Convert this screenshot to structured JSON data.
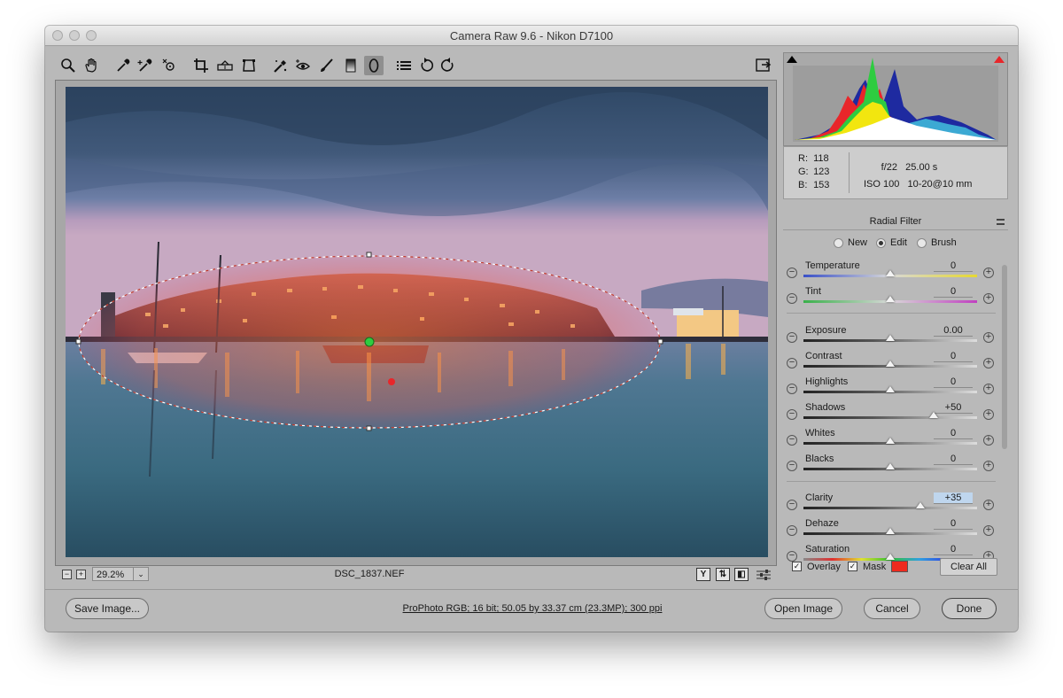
{
  "window": {
    "title": "Camera Raw 9.6  -  Nikon D7100"
  },
  "toolbar": {
    "tools": [
      {
        "name": "zoom-tool",
        "icon": "magnifier-icon"
      },
      {
        "name": "hand-tool",
        "icon": "hand-icon"
      },
      {
        "name": "white-balance-tool",
        "icon": "eyedropper-icon"
      },
      {
        "name": "color-sampler-tool",
        "icon": "eyedropper-plus-icon"
      },
      {
        "name": "targeted-adjustment-tool",
        "icon": "target-icon"
      },
      {
        "name": "crop-tool",
        "icon": "crop-icon"
      },
      {
        "name": "straighten-tool",
        "icon": "level-icon"
      },
      {
        "name": "transform-tool",
        "icon": "transform-icon"
      },
      {
        "name": "spot-removal-tool",
        "icon": "brush-spot-icon"
      },
      {
        "name": "red-eye-tool",
        "icon": "eye-icon"
      },
      {
        "name": "adjustment-brush-tool",
        "icon": "brush-icon"
      },
      {
        "name": "graduated-filter-tool",
        "icon": "gradient-icon"
      },
      {
        "name": "radial-filter-tool",
        "icon": "ellipse-icon"
      },
      {
        "name": "preferences",
        "icon": "list-icon"
      },
      {
        "name": "rotate-left",
        "icon": "rotate-ccw-icon"
      },
      {
        "name": "rotate-right",
        "icon": "rotate-cw-icon"
      }
    ],
    "fullscreen_icon": "fullscreen-icon"
  },
  "status": {
    "zoom": "29.2%",
    "filename": "DSC_1837.NEF",
    "view_buttons": [
      "Y",
      "⇅",
      "◧"
    ]
  },
  "histogram": {
    "shadow_clip_icon": "triangle-black-icon",
    "highlight_clip_icon": "triangle-red-icon",
    "highlight_clip_color": "#e8262a"
  },
  "info": {
    "r_label": "R:",
    "r": "118",
    "g_label": "G:",
    "g": "123",
    "b_label": "B:",
    "b": "153",
    "aperture": "f/22",
    "shutter": "25.00 s",
    "iso": "ISO 100",
    "lens": "10-20@10 mm"
  },
  "panel": {
    "title": "Radial Filter",
    "modes": [
      "New",
      "Edit",
      "Brush"
    ],
    "selected_mode": "Edit",
    "sliders": [
      {
        "label": "Temperature",
        "value": "0",
        "level": 0.5
      },
      {
        "label": "Tint",
        "value": "0",
        "level": 0.5
      },
      {
        "label": "Exposure",
        "value": "0.00",
        "level": 0.5
      },
      {
        "label": "Contrast",
        "value": "0",
        "level": 0.5
      },
      {
        "label": "Highlights",
        "value": "0",
        "level": 0.5
      },
      {
        "label": "Shadows",
        "value": "+50",
        "level": 0.75
      },
      {
        "label": "Whites",
        "value": "0",
        "level": 0.5
      },
      {
        "label": "Blacks",
        "value": "0",
        "level": 0.5
      },
      {
        "label": "Clarity",
        "value": "+35",
        "level": 0.675
      },
      {
        "label": "Dehaze",
        "value": "0",
        "level": 0.5
      },
      {
        "label": "Saturation",
        "value": "0",
        "level": 0.5
      }
    ]
  },
  "options": {
    "overlay_label": "Overlay",
    "overlay_checked": true,
    "mask_label": "Mask",
    "mask_checked": true,
    "mask_color": "#ee2a1e",
    "clear_all": "Clear All"
  },
  "footer": {
    "save": "Save Image...",
    "workflow": "ProPhoto RGB; 16 bit; 50.05 by 33.37 cm (23.3MP); 300 ppi",
    "open": "Open Image",
    "cancel": "Cancel",
    "done": "Done"
  }
}
